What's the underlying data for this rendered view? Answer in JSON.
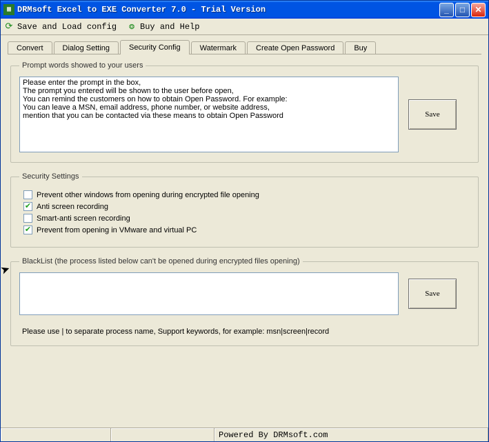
{
  "window": {
    "title": "DRMsoft Excel to EXE Converter 7.0 - Trial Version"
  },
  "toolbar": {
    "save_load": "Save and Load config",
    "buy_help": "Buy and Help"
  },
  "tabs": [
    {
      "label": "Convert"
    },
    {
      "label": "Dialog Setting"
    },
    {
      "label": "Security Config"
    },
    {
      "label": "Watermark"
    },
    {
      "label": "Create Open Password"
    },
    {
      "label": "Buy"
    }
  ],
  "prompt_group": {
    "legend": "Prompt words  showed to your users",
    "text": "Please enter the prompt in the box,\nThe prompt you entered will be shown to the user before open,\nYou can remind the customers on how to obtain Open Password. For example:\nYou can leave a MSN, email address, phone number, or website address,\nmention that you can be contacted via these means to obtain Open Password",
    "save": "Save"
  },
  "security_group": {
    "legend": "Security Settings",
    "opts": [
      {
        "checked": false,
        "label": "Prevent other windows from opening during encrypted file opening"
      },
      {
        "checked": true,
        "label": "Anti screen recording"
      },
      {
        "checked": false,
        "label": "Smart-anti screen recording"
      },
      {
        "checked": true,
        "label": "Prevent from opening in VMware and virtual PC"
      }
    ]
  },
  "blacklist_group": {
    "legend": "BlackList (the process listed below can't be opened during encrypted files opening)",
    "text": "",
    "save": "Save",
    "hint": "Please use | to separate process name, Support keywords,  for example:  msn|screen|record"
  },
  "status": {
    "powered": "Powered By DRMsoft.com"
  }
}
